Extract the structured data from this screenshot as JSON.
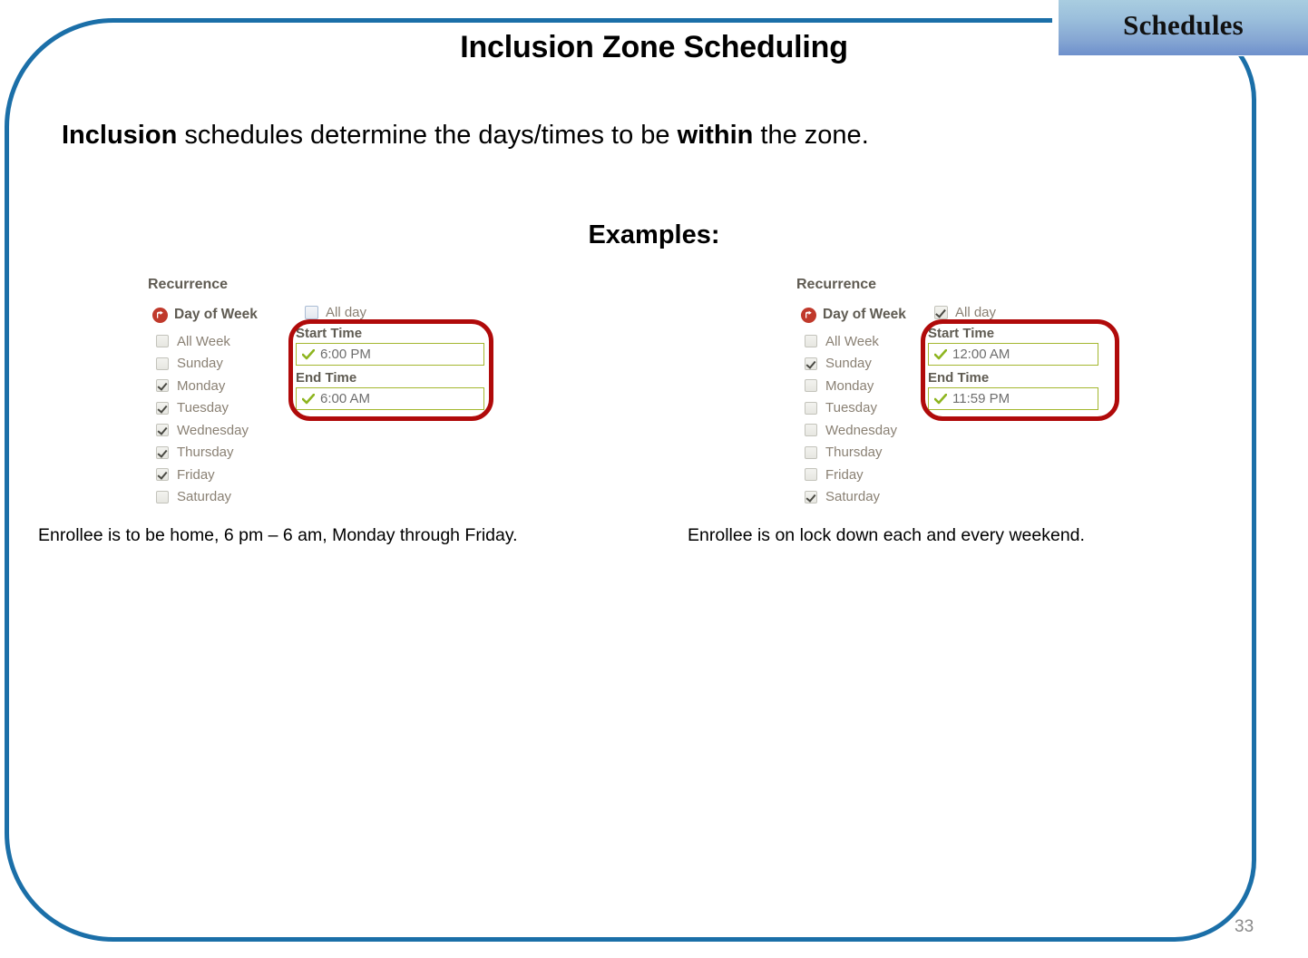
{
  "section_chip": {
    "label": "Schedules",
    "gradient_top": "#a9cde0",
    "gradient_bottom": "#6e90cc"
  },
  "frame": {
    "border_color": "#1B6FA8"
  },
  "slide": {
    "title": "Inclusion Zone Scheduling",
    "lead_prefix_bold": "Inclusion",
    "lead_middle": " schedules determine the days/times to be ",
    "lead_bold2": "within",
    "lead_suffix": " the zone.",
    "examples_heading": "Examples:",
    "page_number": "33"
  },
  "examples": [
    {
      "recurrence_title": "Recurrence",
      "day_of_week_label": "Day of Week",
      "day_of_week_icon": "red-circle-arrow-icon",
      "days": [
        {
          "label": "All Week",
          "checked": false
        },
        {
          "label": "Sunday",
          "checked": false
        },
        {
          "label": "Monday",
          "checked": true
        },
        {
          "label": "Tuesday",
          "checked": true
        },
        {
          "label": "Wednesday",
          "checked": true
        },
        {
          "label": "Thursday",
          "checked": true
        },
        {
          "label": "Friday",
          "checked": true
        },
        {
          "label": "Saturday",
          "checked": false
        }
      ],
      "all_day": {
        "label": "All day",
        "checked": false
      },
      "start_time": {
        "caption": "Start Time",
        "value": "6:00 PM"
      },
      "end_time": {
        "caption": "End Time",
        "value": "6:00 AM"
      },
      "caption": "Enrollee is to be home, 6 pm – 6 am, Monday through Friday.",
      "highlight_color": "#b00a0a",
      "field_border_color": "#a4b72f"
    },
    {
      "recurrence_title": "Recurrence",
      "day_of_week_label": "Day of Week",
      "day_of_week_icon": "red-circle-arrow-icon",
      "days": [
        {
          "label": "All Week",
          "checked": false
        },
        {
          "label": "Sunday",
          "checked": true
        },
        {
          "label": "Monday",
          "checked": false
        },
        {
          "label": "Tuesday",
          "checked": false
        },
        {
          "label": "Wednesday",
          "checked": false
        },
        {
          "label": "Thursday",
          "checked": false
        },
        {
          "label": "Friday",
          "checked": false
        },
        {
          "label": "Saturday",
          "checked": true
        }
      ],
      "all_day": {
        "label": "All day",
        "checked": true
      },
      "start_time": {
        "caption": "Start Time",
        "value": "12:00 AM"
      },
      "end_time": {
        "caption": "End Time",
        "value": "11:59 PM"
      },
      "caption": "Enrollee is on lock down each and every weekend.",
      "highlight_color": "#b00a0a",
      "field_border_color": "#a4b72f"
    }
  ]
}
